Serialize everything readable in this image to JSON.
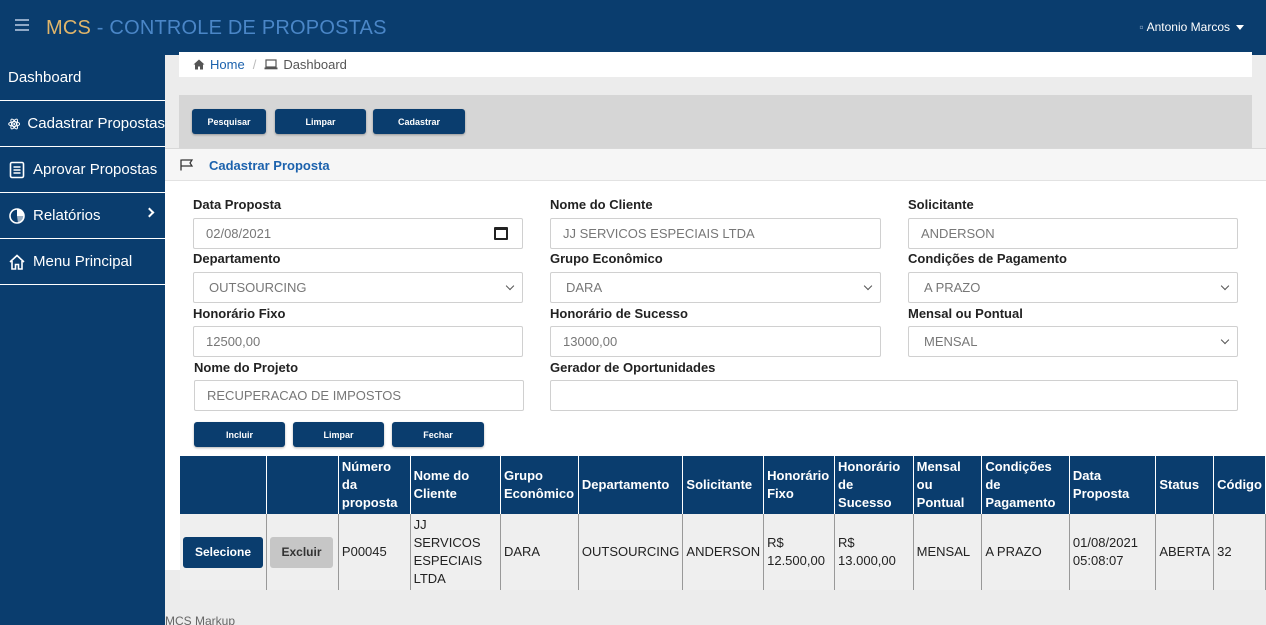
{
  "header": {
    "brand_prefix": "MCS",
    "brand_suffix": " - CONTROLE DE PROPOSTAS",
    "user_name": "Antonio Marcos"
  },
  "sidebar": {
    "items": [
      {
        "label": "Dashboard"
      },
      {
        "label": "Cadastrar Propostas"
      },
      {
        "label": "Aprovar Propostas"
      },
      {
        "label": "Relatórios"
      },
      {
        "label": "Menu Principal"
      }
    ]
  },
  "breadcrumb": {
    "home": "Home",
    "current": "Dashboard"
  },
  "toolbar": {
    "search_label": "Pesquisar",
    "clear_label": "Limpar",
    "register_label": "Cadastrar"
  },
  "panel": {
    "title": "Cadastrar Proposta"
  },
  "form": {
    "data_proposta_label": "Data Proposta",
    "data_proposta_value": "02/08/2021",
    "nome_cliente_label": "Nome do Cliente",
    "nome_cliente_value": "JJ SERVICOS ESPECIAIS LTDA",
    "solicitante_label": "Solicitante",
    "solicitante_value": "ANDERSON",
    "departamento_label": "Departamento",
    "departamento_value": "OUTSOURCING",
    "grupo_label": "Grupo Econômico",
    "grupo_value": "DARA",
    "condicoes_label": "Condições de Pagamento",
    "condicoes_value": "A PRAZO",
    "hon_fixo_label": "Honorário Fixo",
    "hon_fixo_value": "12500,00",
    "hon_sucesso_label": "Honorário de Sucesso",
    "hon_sucesso_value": "13000,00",
    "mensal_label": "Mensal ou Pontual",
    "mensal_value": "MENSAL",
    "projeto_label": "Nome do Projeto",
    "projeto_value": "RECUPERACAO DE IMPOSTOS",
    "gerador_label": "Gerador de Oportunidades",
    "gerador_value": ""
  },
  "form_actions": {
    "include_label": "Incluir",
    "clear_label": "Limpar",
    "close_label": "Fechar"
  },
  "table": {
    "headers": [
      "",
      "",
      "Número da proposta",
      "Nome do Cliente",
      "Grupo Econômico",
      "Departamento",
      "Solicitante",
      "Honorário Fixo",
      "Honorário de Sucesso",
      "Mensal ou Pontual",
      "Condições de Pagamento",
      "Data Proposta",
      "Status",
      "Código"
    ],
    "rows": [
      {
        "select_label": "Selecione",
        "delete_label": "Excluir",
        "numero": "P00045",
        "cliente": "JJ SERVICOS ESPECIAIS LTDA",
        "grupo": "DARA",
        "departamento": "OUTSOURCING",
        "solicitante": "ANDERSON",
        "hon_fixo": "R$ 12.500,00",
        "hon_sucesso": "R$ 13.000,00",
        "mensal": "MENSAL",
        "condicoes": "A PRAZO",
        "data": "01/08/2021 05:08:07",
        "status": "ABERTA",
        "codigo": "32"
      }
    ]
  },
  "footer": {
    "text": "MCS Markup"
  },
  "colors": {
    "primary": "#0a3d6e",
    "brand_gold": "#e0b56a",
    "brand_blue": "#4a86c7",
    "link": "#1c62ad"
  }
}
